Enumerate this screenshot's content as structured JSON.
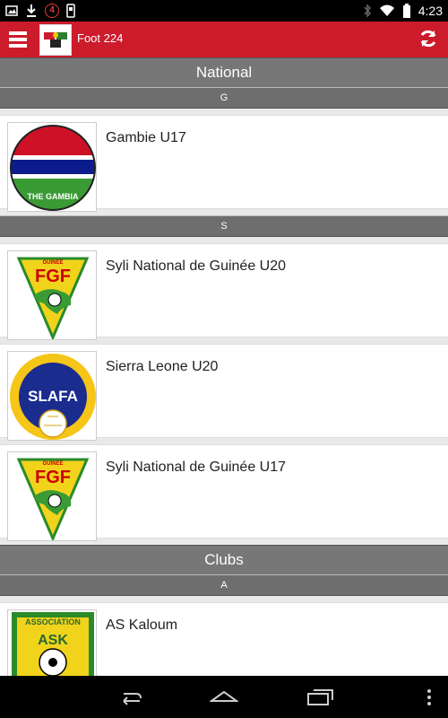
{
  "status_bar": {
    "time": "4:23",
    "notif_badge": "4"
  },
  "app_bar": {
    "title": "Foot 224"
  },
  "sections": [
    {
      "title": "National"
    },
    {
      "title": "Clubs"
    }
  ],
  "national": {
    "groups": [
      {
        "letter": "G",
        "items": [
          {
            "name": "Gambie U17",
            "logo_text": "THE GAMBIA"
          }
        ]
      },
      {
        "letter": "S",
        "items": [
          {
            "name": "Syli National de Guinée U20",
            "logo_text": "FGF"
          },
          {
            "name": "Sierra Leone U20",
            "logo_text": "SLAFA"
          },
          {
            "name": "Syli National de Guinée U17",
            "logo_text": "FGF"
          }
        ]
      }
    ]
  },
  "clubs": {
    "groups": [
      {
        "letter": "A",
        "items": [
          {
            "name": "AS Kaloum",
            "logo_text": "ASK"
          }
        ]
      }
    ]
  },
  "logo_labels": {
    "guinee": "GUINEE",
    "association": "ASSOCIATION"
  },
  "colors": {
    "appbar": "#cc1b2b",
    "section_bg": "#777777",
    "background": "#e9e9e9"
  }
}
